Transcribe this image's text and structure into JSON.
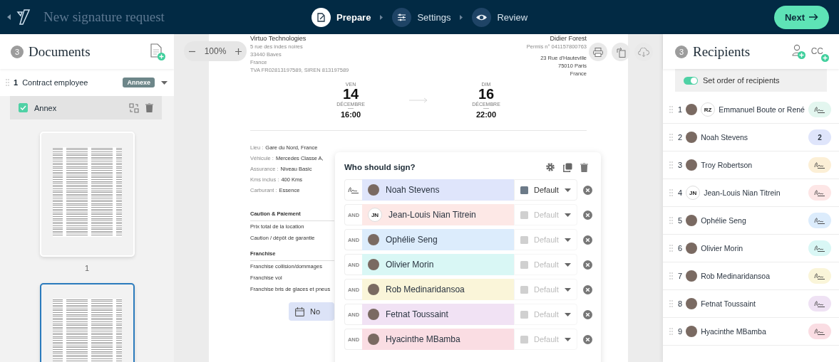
{
  "header": {
    "title": "New signature request",
    "steps": [
      {
        "kind": "prepare",
        "label": "Prepare",
        "selected": true
      },
      {
        "kind": "settings",
        "label": "Settings",
        "selected": false
      },
      {
        "kind": "review",
        "label": "Review",
        "selected": false
      }
    ],
    "next_button": "Next"
  },
  "documents": {
    "count": "3",
    "title": "Documents",
    "items": [
      {
        "number": "1",
        "name": "Contract employee",
        "tag": "Annexe",
        "expanded": true,
        "attachments": [
          {
            "name": "Annex",
            "checked": true
          }
        ]
      }
    ],
    "pages": [
      {
        "label": "1",
        "selected": false
      },
      {
        "selected": true
      }
    ]
  },
  "viewer": {
    "zoom": "100%",
    "document": {
      "sender": {
        "name": "Virtuo Technologies",
        "lines": [
          "5 rue des indes noires",
          "33440 Baves",
          "France",
          "TVA FR02813197589, SIREN 813197589"
        ]
      },
      "recipient": {
        "name": "Didier Forest",
        "license": "Permis n° 041157800763",
        "address": [
          "23 Rue d'Hauteville",
          "75010 Paris",
          "France"
        ]
      },
      "dates": [
        {
          "weekday": "VEN",
          "day": "14",
          "month": "DÉCEMBRE",
          "time": "16:00"
        },
        {
          "weekday": "DIM",
          "day": "16",
          "month": "DÉCEMBRE",
          "time": "22:00"
        }
      ],
      "details": [
        {
          "label": "Lieu :",
          "value": "Gare du Nord, France"
        },
        {
          "label": "Véhicule :",
          "value": "Mercedes Classe A,"
        },
        {
          "label": "Assurance :",
          "value": "Niveau Basic"
        },
        {
          "label": "Kms inclus :",
          "value": "400 Kms"
        },
        {
          "label": "Carburant :",
          "value": "Essence"
        }
      ],
      "sections": [
        {
          "title": "Caution & Paiement",
          "rows": [
            "Prix total de la location",
            "Caution / dépôt de garantie"
          ]
        },
        {
          "title": "Franchise",
          "rows": [
            "Franchise collision/dommages",
            "Franchise vol",
            "Franchise bris de glaces et pneus"
          ]
        }
      ],
      "date_chip": "No"
    }
  },
  "signers": {
    "title": "Who should sign?",
    "rows": [
      {
        "kind": "signature",
        "name": "Noah Stevens",
        "color": "#dfe5fb",
        "role": "Default",
        "disabled": false
      },
      {
        "kind": "and",
        "connector": "AND",
        "name": "Jean-Louis Nian Titrein",
        "initials": "JN",
        "color": "#fde8e6",
        "role": "Default",
        "disabled": true
      },
      {
        "kind": "and",
        "connector": "AND",
        "name": "Ophélie Seng",
        "color": "#dcecfc",
        "role": "Default",
        "disabled": true
      },
      {
        "kind": "and",
        "connector": "AND",
        "name": "Olivier Morin",
        "color": "#d9f7f5",
        "role": "Default",
        "disabled": true
      },
      {
        "kind": "and",
        "connector": "AND",
        "name": "Rob Medinaridansoa",
        "color": "#faf5d9",
        "role": "Default",
        "disabled": true
      },
      {
        "kind": "and",
        "connector": "AND",
        "name": "Fetnat Toussaint",
        "color": "#f1e2f4",
        "role": "Default",
        "disabled": true
      },
      {
        "kind": "and",
        "connector": "AND",
        "name": "Hyacinthe MBamba",
        "color": "#fadde3",
        "role": "Default",
        "disabled": true
      }
    ]
  },
  "recipients": {
    "count": "3",
    "title": "Recipients",
    "cc_button": "CC",
    "order_toggle": {
      "label": "Set order of recipients",
      "on": true
    },
    "items": [
      {
        "number": "1",
        "name": "Emmanuel Boute or René",
        "photo": true,
        "initials": "RZ",
        "badge": {
          "kind": "signature",
          "color": "#e3f6ef"
        }
      },
      {
        "number": "2",
        "name": "Noah Stevens",
        "photo": true,
        "badge": {
          "kind": "order",
          "text": "2",
          "color": "#dfe5fb"
        }
      },
      {
        "number": "3",
        "name": "Troy Robertson",
        "photo": true,
        "badge": {
          "kind": "signature",
          "color": "#fcefd6"
        }
      },
      {
        "number": "4",
        "name": "Jean-Louis Nian Titrein",
        "photo": false,
        "initials": "JN",
        "badge": {
          "kind": "signature",
          "color": "#fde6e6"
        }
      },
      {
        "number": "5",
        "name": "Ophélie Seng",
        "photo": true,
        "badge": {
          "kind": "signature",
          "color": "#dcecfc"
        }
      },
      {
        "number": "6",
        "name": "Olivier Morin",
        "photo": true,
        "badge": {
          "kind": "signature",
          "color": "#d9f7f5"
        }
      },
      {
        "number": "7",
        "name": "Rob Medinaridansoa",
        "photo": true,
        "badge": {
          "kind": "signature",
          "color": "#faf5d9"
        }
      },
      {
        "number": "8",
        "name": "Fetnat Toussaint",
        "photo": true,
        "badge": {
          "kind": "signature",
          "color": "#efe2f4"
        }
      },
      {
        "number": "9",
        "name": "Hyacinthe MBamba",
        "photo": true,
        "badge": {
          "kind": "signature",
          "color": "#fadde3"
        }
      }
    ]
  }
}
